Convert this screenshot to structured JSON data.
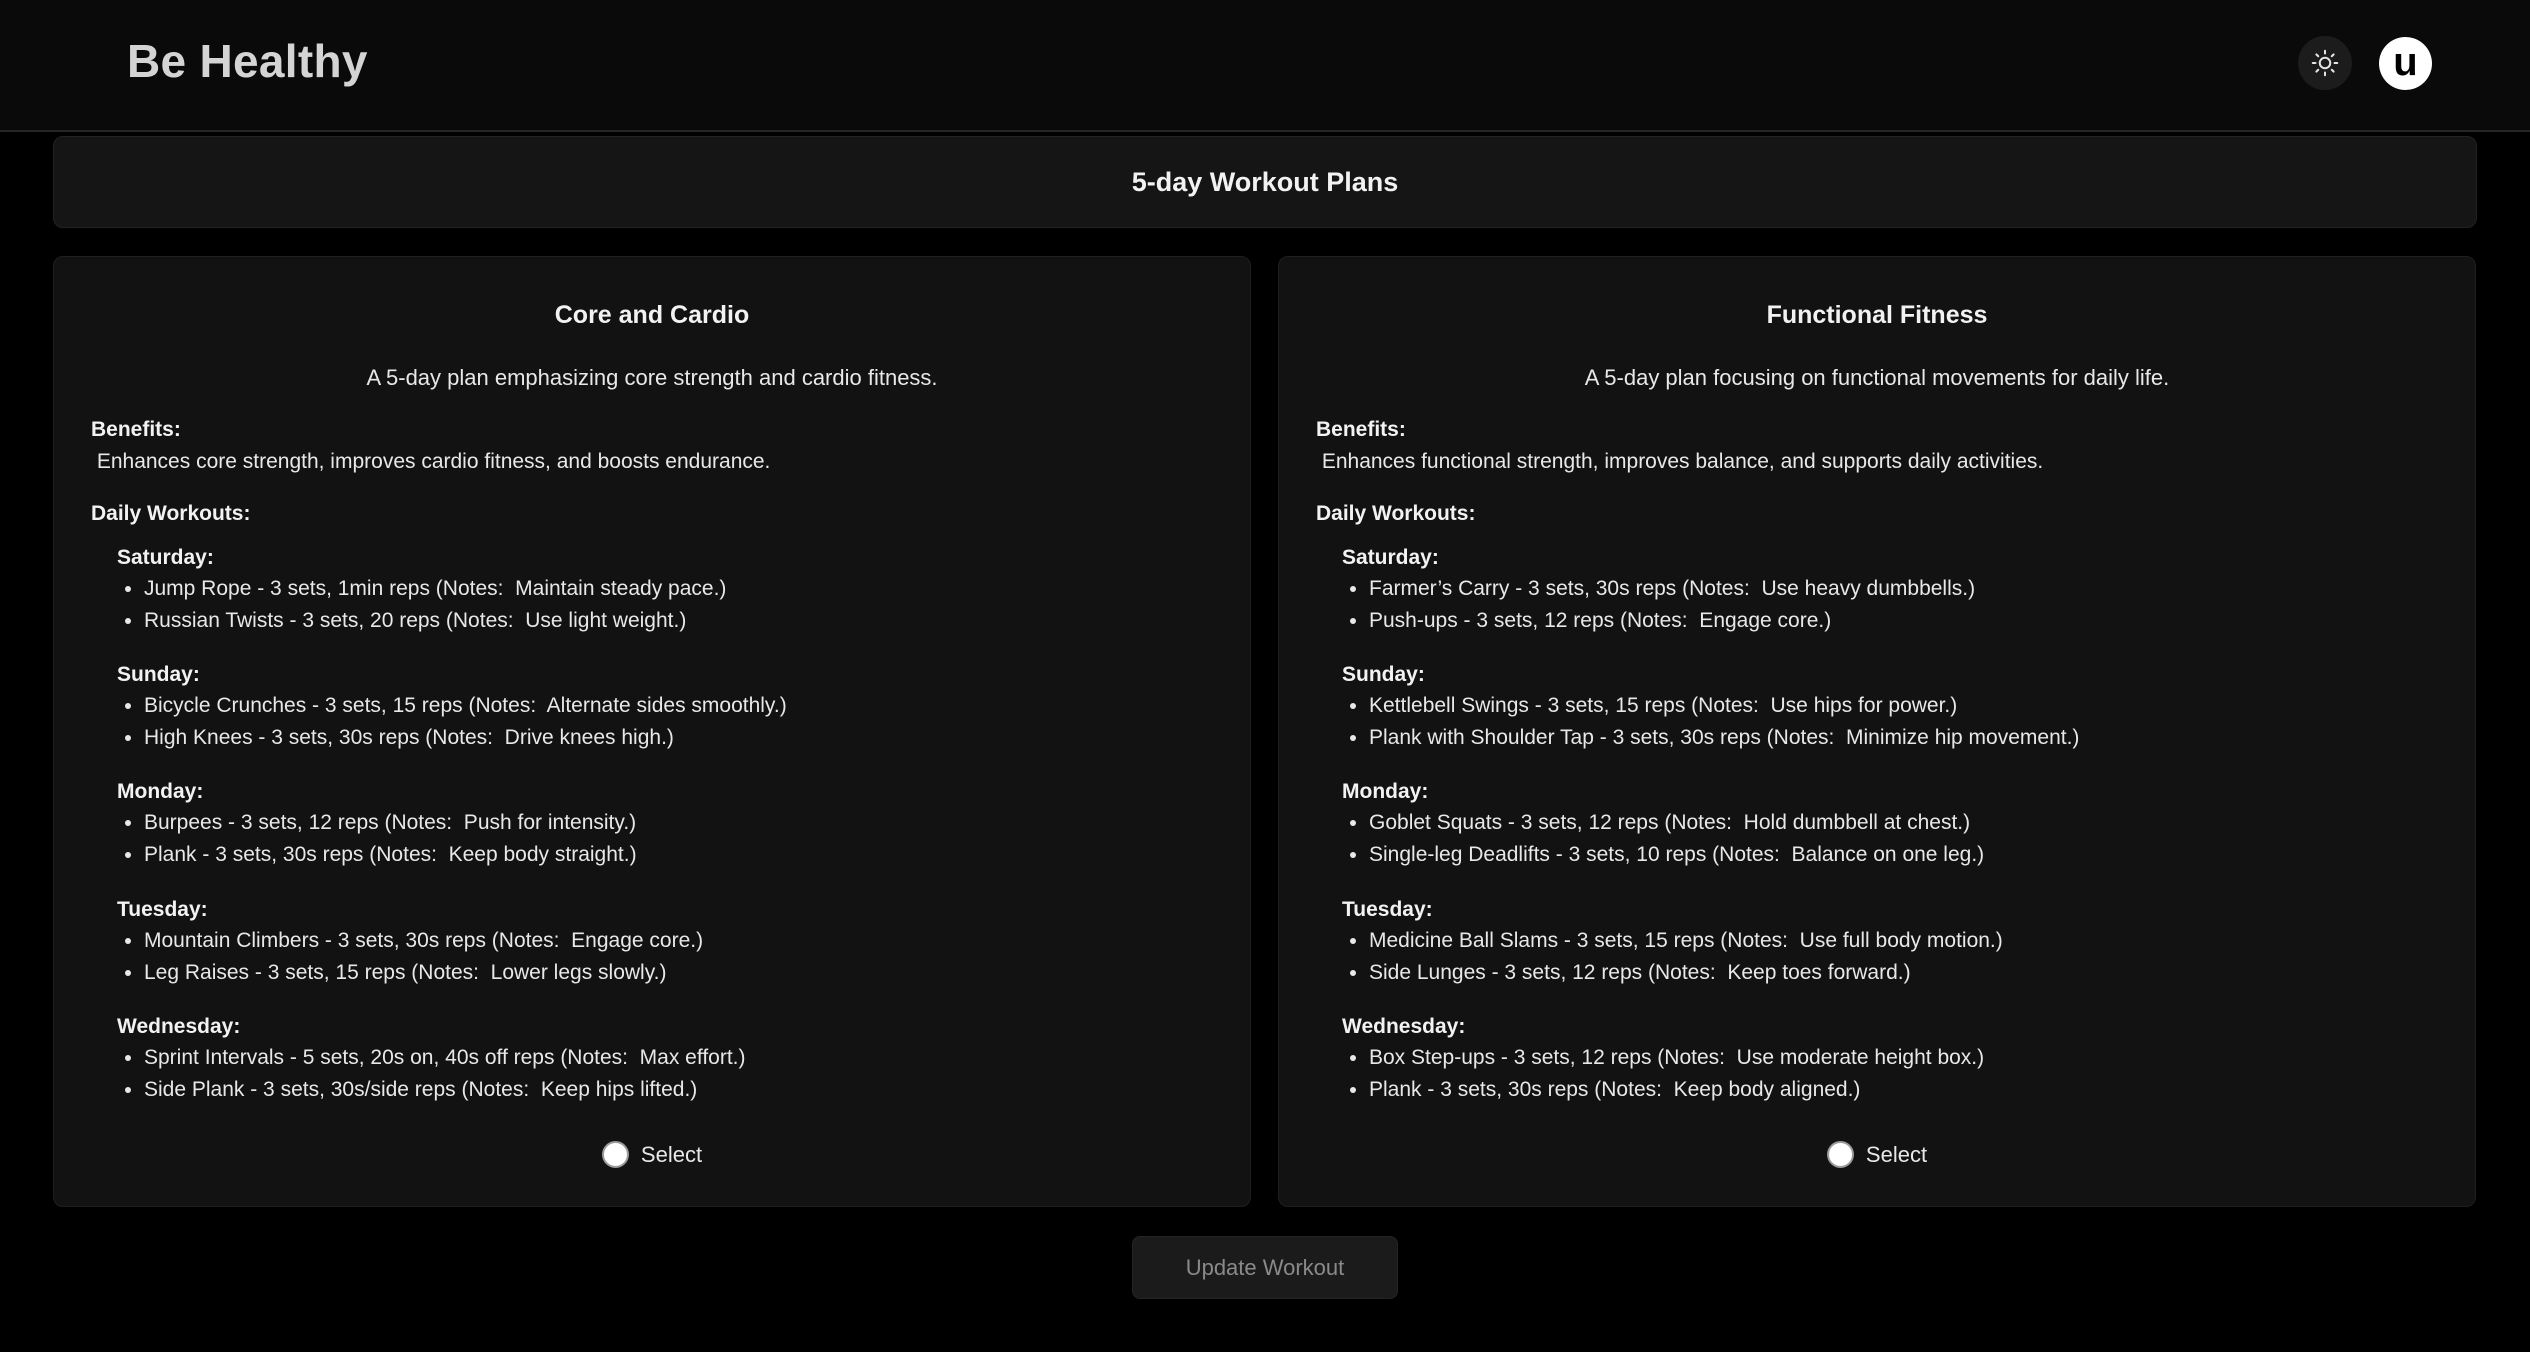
{
  "app": {
    "brand": "Be Healthy",
    "avatar_letter": "u"
  },
  "page": {
    "title": "5-day Workout Plans",
    "update_button": "Update Workout"
  },
  "labels": {
    "benefits": "Benefits:",
    "daily_workouts": "Daily Workouts:",
    "select": "Select"
  },
  "plans": [
    {
      "title": "Core and Cardio",
      "description": "A 5-day plan emphasizing core strength and cardio fitness.",
      "benefits": " Enhances core strength, improves cardio fitness, and boosts endurance.",
      "days": [
        {
          "name": "Saturday:",
          "exercises": [
            "Jump Rope - 3 sets, 1min reps (Notes:  Maintain steady pace.)",
            "Russian Twists - 3 sets, 20 reps (Notes:  Use light weight.)"
          ]
        },
        {
          "name": "Sunday:",
          "exercises": [
            "Bicycle Crunches - 3 sets, 15 reps (Notes:  Alternate sides smoothly.)",
            "High Knees - 3 sets, 30s reps (Notes:  Drive knees high.)"
          ]
        },
        {
          "name": "Monday:",
          "exercises": [
            "Burpees - 3 sets, 12 reps (Notes:  Push for intensity.)",
            "Plank - 3 sets, 30s reps (Notes:  Keep body straight.)"
          ]
        },
        {
          "name": "Tuesday:",
          "exercises": [
            "Mountain Climbers - 3 sets, 30s reps (Notes:  Engage core.)",
            "Leg Raises - 3 sets, 15 reps (Notes:  Lower legs slowly.)"
          ]
        },
        {
          "name": "Wednesday:",
          "exercises": [
            "Sprint Intervals - 5 sets, 20s on, 40s off reps (Notes:  Max effort.)",
            "Side Plank - 3 sets, 30s/side reps (Notes:  Keep hips lifted.)"
          ]
        }
      ]
    },
    {
      "title": "Functional Fitness",
      "description": "A 5-day plan focusing on functional movements for daily life.",
      "benefits": " Enhances functional strength, improves balance, and supports daily activities.",
      "days": [
        {
          "name": "Saturday:",
          "exercises": [
            "Farmer’s Carry - 3 sets, 30s reps (Notes:  Use heavy dumbbells.)",
            "Push-ups - 3 sets, 12 reps (Notes:  Engage core.)"
          ]
        },
        {
          "name": "Sunday:",
          "exercises": [
            "Kettlebell Swings - 3 sets, 15 reps (Notes:  Use hips for power.)",
            "Plank with Shoulder Tap - 3 sets, 30s reps (Notes:  Minimize hip movement.)"
          ]
        },
        {
          "name": "Monday:",
          "exercises": [
            "Goblet Squats - 3 sets, 12 reps (Notes:  Hold dumbbell at chest.)",
            "Single-leg Deadlifts - 3 sets, 10 reps (Notes:  Balance on one leg.)"
          ]
        },
        {
          "name": "Tuesday:",
          "exercises": [
            "Medicine Ball Slams - 3 sets, 15 reps (Notes:  Use full body motion.)",
            "Side Lunges - 3 sets, 12 reps (Notes:  Keep toes forward.)"
          ]
        },
        {
          "name": "Wednesday:",
          "exercises": [
            "Box Step-ups - 3 sets, 12 reps (Notes:  Use moderate height box.)",
            "Plank - 3 sets, 30s reps (Notes:  Keep body aligned.)"
          ]
        }
      ]
    }
  ]
}
